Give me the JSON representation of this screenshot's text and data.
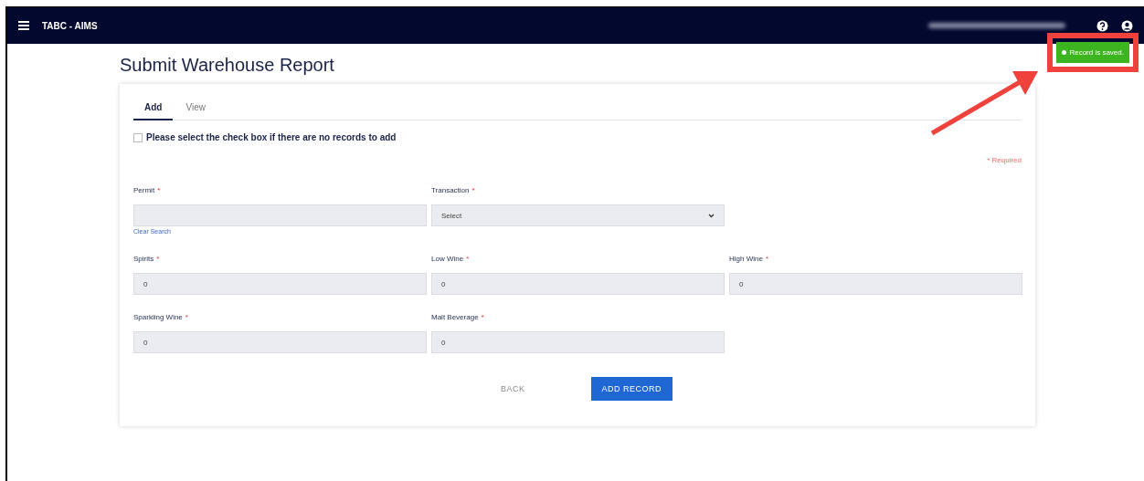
{
  "app": {
    "title": "TABC - AIMS"
  },
  "notification": {
    "kind": "success",
    "message": "Record is saved."
  },
  "page_title": "Submit Warehouse Report",
  "tabs": [
    {
      "label": "Add",
      "selected": true
    },
    {
      "label": "View",
      "selected": false
    }
  ],
  "no_records_checkbox": {
    "label": "Please select the check box if there are no records to add",
    "checked": false
  },
  "required_mark": "*",
  "required_note": "* Required",
  "field_rows": [
    [
      {
        "kind": "text",
        "label": "Permit",
        "required": true,
        "link": "Clear Search"
      },
      {
        "kind": "select",
        "label": "Transaction",
        "required": true,
        "value": "Select"
      }
    ],
    [
      {
        "kind": "text",
        "label": "Spirits",
        "required": true,
        "value": "0"
      },
      {
        "kind": "text",
        "label": "Low Wine",
        "required": true,
        "value": "0"
      },
      {
        "kind": "text",
        "label": "High Wine",
        "required": true,
        "value": "0"
      }
    ],
    [
      {
        "kind": "text",
        "label": "Sparkling Wine",
        "required": true,
        "value": "0"
      },
      {
        "kind": "text",
        "label": "Malt Beverage",
        "required": true,
        "value": "0"
      }
    ]
  ],
  "buttons": [
    {
      "kind": "flat",
      "label": "BACK"
    },
    {
      "kind": "primary",
      "label": "ADD RECORD"
    }
  ]
}
